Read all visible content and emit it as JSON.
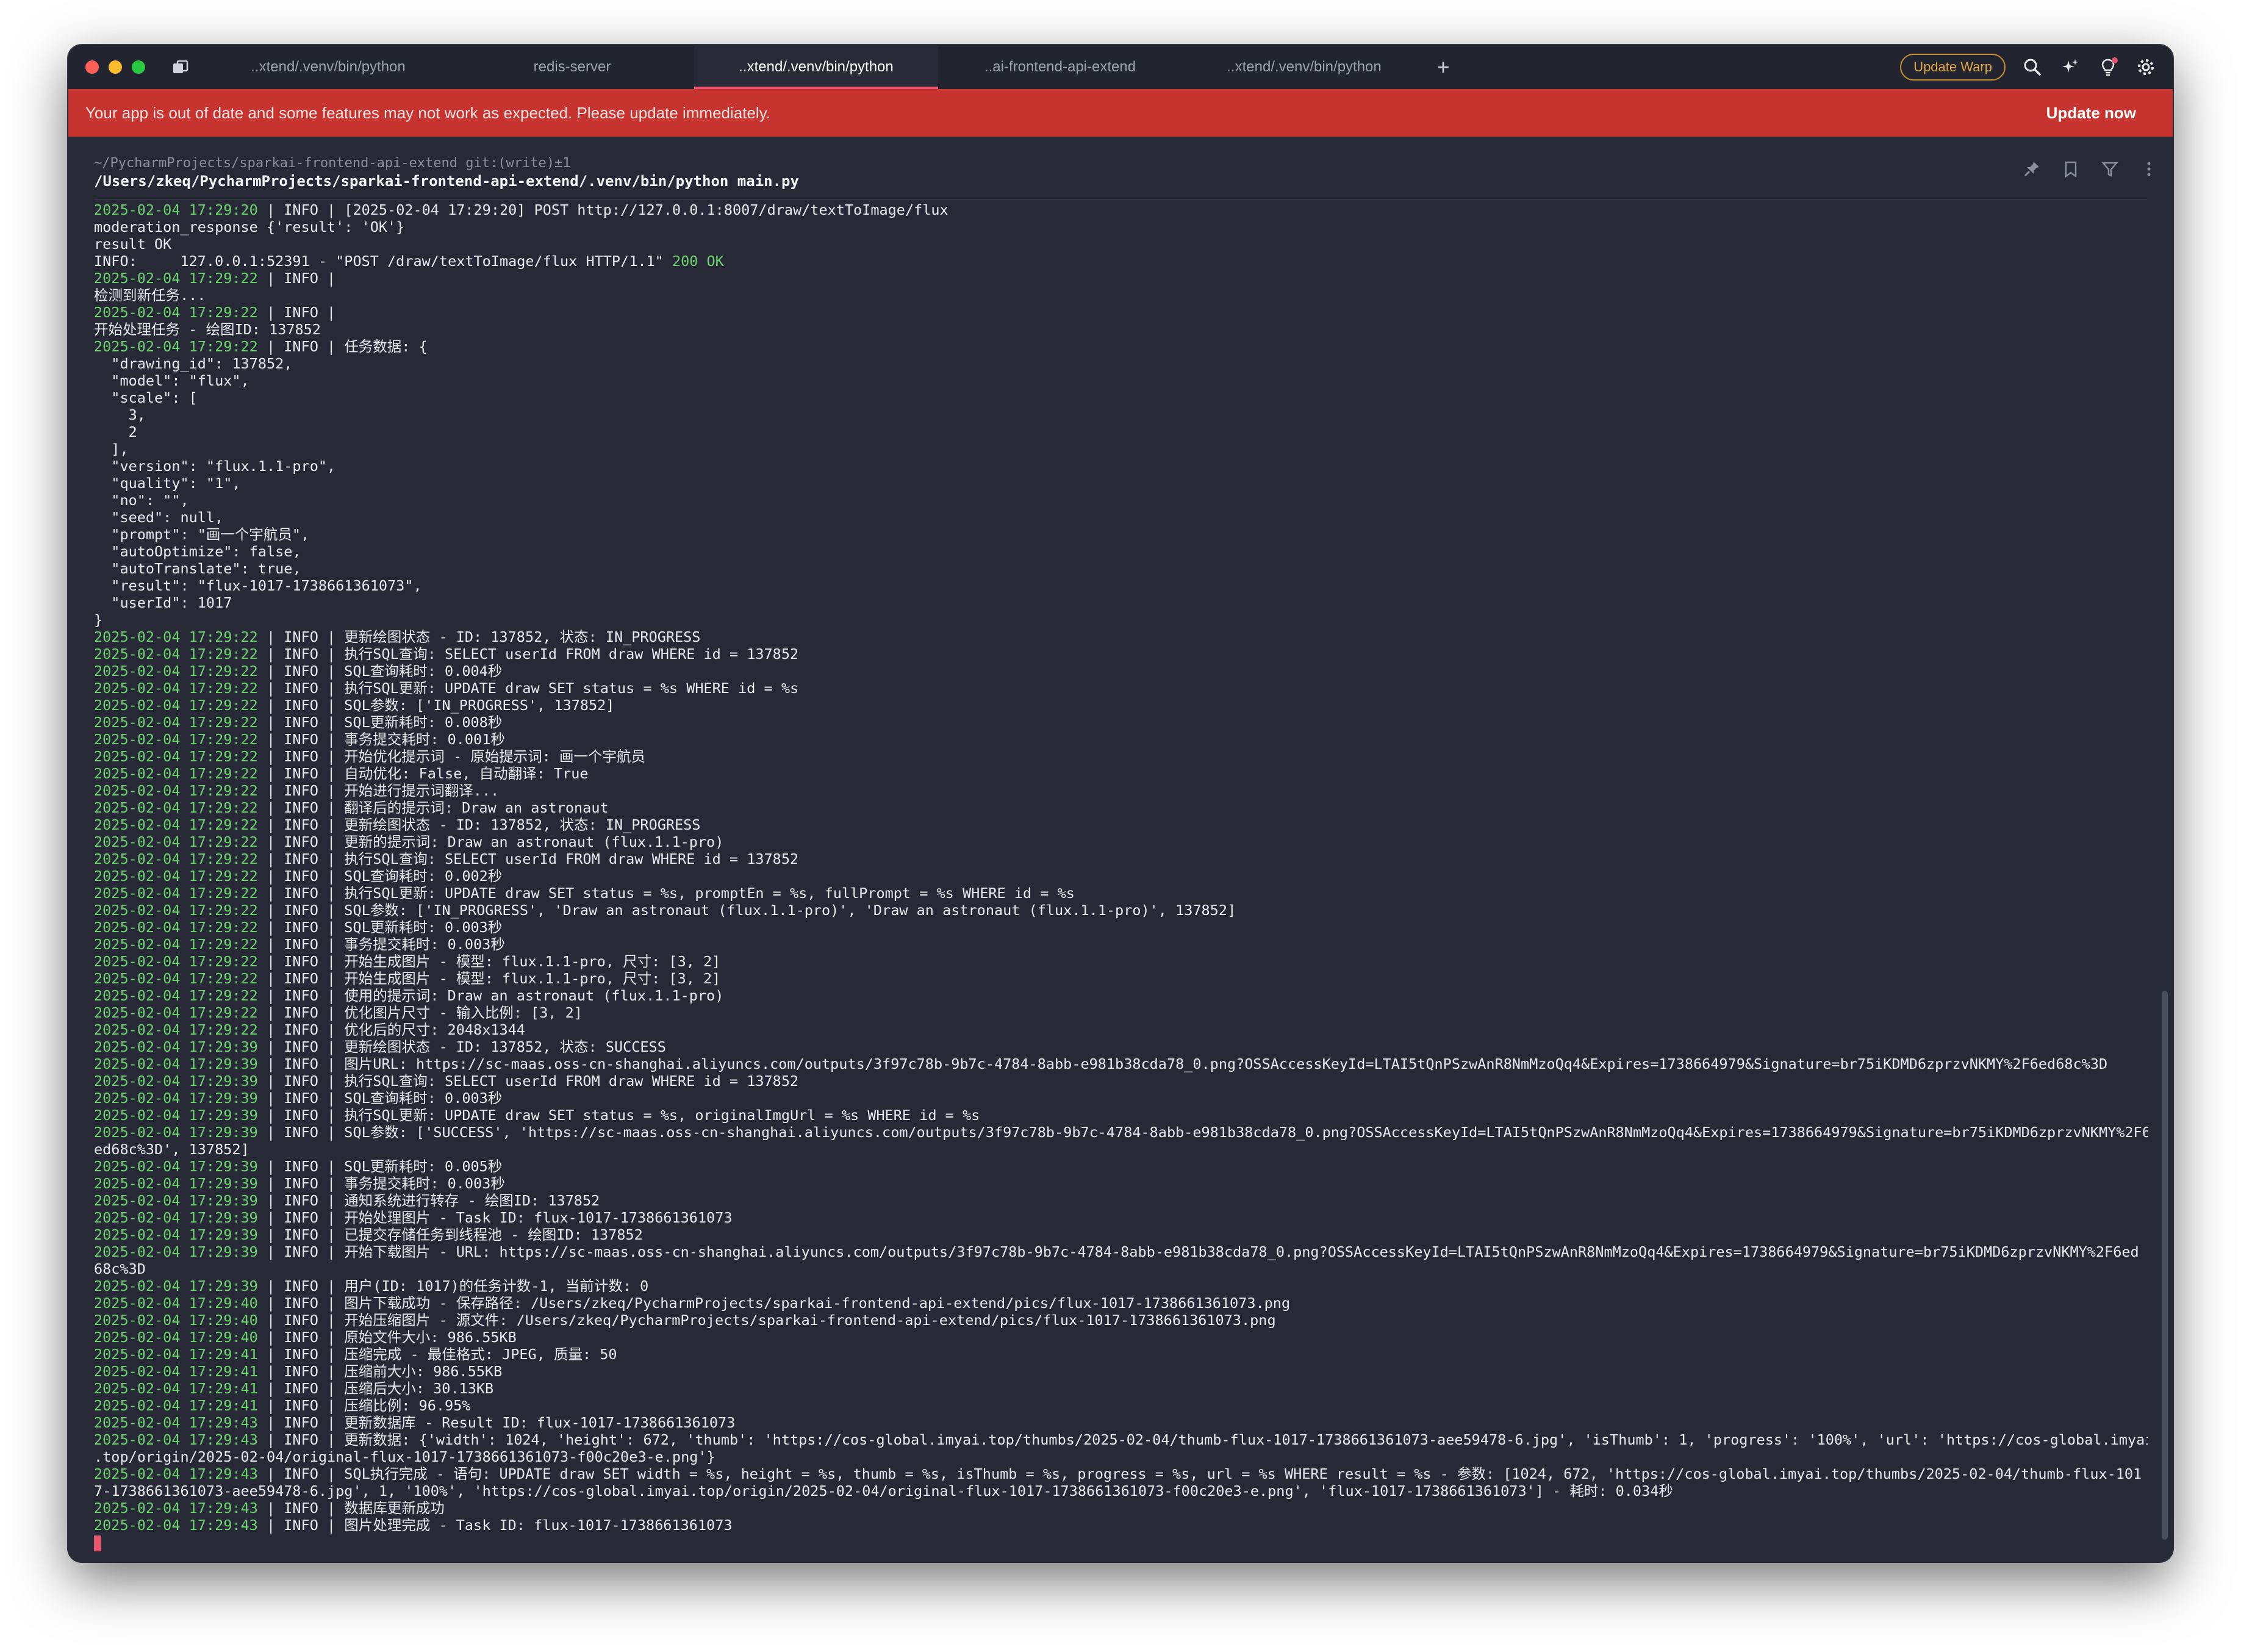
{
  "tabs": [
    {
      "label": "..xtend/.venv/bin/python",
      "active": false
    },
    {
      "label": "redis-server",
      "active": false
    },
    {
      "label": "..xtend/.venv/bin/python",
      "active": true
    },
    {
      "label": "..ai-frontend-api-extend",
      "active": false
    },
    {
      "label": "..xtend/.venv/bin/python",
      "active": false
    }
  ],
  "toolbar": {
    "new_tab": "+",
    "update_warp": "Update Warp"
  },
  "banner": {
    "message": "Your app is out of date and some features may not work as expected. Please update immediately.",
    "action": "Update now",
    "color": "#c73430"
  },
  "block": {
    "prompt": "~/PycharmProjects/sparkai-frontend-api-extend git:(write)±1",
    "command": "/Users/zkeq/PycharmProjects/sparkai-frontend-api-extend/.venv/bin/python main.py"
  },
  "log": [
    {
      "ts": "2025-02-04 17:29:20",
      "text": " | INFO | [2025-02-04 17:29:20] POST http://127.0.0.1:8007/draw/textToImage/flux"
    },
    {
      "text": "moderation_response {'result': 'OK'}"
    },
    {
      "text": "result OK"
    },
    {
      "text": "INFO:     127.0.0.1:52391 - \"POST /draw/textToImage/flux HTTP/1.1\" ",
      "ok": "200 OK"
    },
    {
      "ts": "2025-02-04 17:29:22",
      "text": " | INFO |"
    },
    {
      "text": "检测到新任务..."
    },
    {
      "ts": "2025-02-04 17:29:22",
      "text": " | INFO |"
    },
    {
      "text": "开始处理任务 - 绘图ID: 137852"
    },
    {
      "ts": "2025-02-04 17:29:22",
      "text": " | INFO | 任务数据: {"
    },
    {
      "text": "  \"drawing_id\": 137852,"
    },
    {
      "text": "  \"model\": \"flux\","
    },
    {
      "text": "  \"scale\": ["
    },
    {
      "text": "    3,"
    },
    {
      "text": "    2"
    },
    {
      "text": "  ],"
    },
    {
      "text": "  \"version\": \"flux.1.1-pro\","
    },
    {
      "text": "  \"quality\": \"1\","
    },
    {
      "text": "  \"no\": \"\","
    },
    {
      "text": "  \"seed\": null,"
    },
    {
      "text": "  \"prompt\": \"画一个宇航员\","
    },
    {
      "text": "  \"autoOptimize\": false,"
    },
    {
      "text": "  \"autoTranslate\": true,"
    },
    {
      "text": "  \"result\": \"flux-1017-1738661361073\","
    },
    {
      "text": "  \"userId\": 1017"
    },
    {
      "text": "}"
    },
    {
      "ts": "2025-02-04 17:29:22",
      "text": " | INFO | 更新绘图状态 - ID: 137852, 状态: IN_PROGRESS"
    },
    {
      "ts": "2025-02-04 17:29:22",
      "text": " | INFO | 执行SQL查询: SELECT userId FROM draw WHERE id = 137852"
    },
    {
      "ts": "2025-02-04 17:29:22",
      "text": " | INFO | SQL查询耗时: 0.004秒"
    },
    {
      "ts": "2025-02-04 17:29:22",
      "text": " | INFO | 执行SQL更新: UPDATE draw SET status = %s WHERE id = %s"
    },
    {
      "ts": "2025-02-04 17:29:22",
      "text": " | INFO | SQL参数: ['IN_PROGRESS', 137852]"
    },
    {
      "ts": "2025-02-04 17:29:22",
      "text": " | INFO | SQL更新耗时: 0.008秒"
    },
    {
      "ts": "2025-02-04 17:29:22",
      "text": " | INFO | 事务提交耗时: 0.001秒"
    },
    {
      "ts": "2025-02-04 17:29:22",
      "text": " | INFO | 开始优化提示词 - 原始提示词: 画一个宇航员"
    },
    {
      "ts": "2025-02-04 17:29:22",
      "text": " | INFO | 自动优化: False, 自动翻译: True"
    },
    {
      "ts": "2025-02-04 17:29:22",
      "text": " | INFO | 开始进行提示词翻译..."
    },
    {
      "ts": "2025-02-04 17:29:22",
      "text": " | INFO | 翻译后的提示词: Draw an astronaut"
    },
    {
      "ts": "2025-02-04 17:29:22",
      "text": " | INFO | 更新绘图状态 - ID: 137852, 状态: IN_PROGRESS"
    },
    {
      "ts": "2025-02-04 17:29:22",
      "text": " | INFO | 更新的提示词: Draw an astronaut (flux.1.1-pro)"
    },
    {
      "ts": "2025-02-04 17:29:22",
      "text": " | INFO | 执行SQL查询: SELECT userId FROM draw WHERE id = 137852"
    },
    {
      "ts": "2025-02-04 17:29:22",
      "text": " | INFO | SQL查询耗时: 0.002秒"
    },
    {
      "ts": "2025-02-04 17:29:22",
      "text": " | INFO | 执行SQL更新: UPDATE draw SET status = %s, promptEn = %s, fullPrompt = %s WHERE id = %s"
    },
    {
      "ts": "2025-02-04 17:29:22",
      "text": " | INFO | SQL参数: ['IN_PROGRESS', 'Draw an astronaut (flux.1.1-pro)', 'Draw an astronaut (flux.1.1-pro)', 137852]"
    },
    {
      "ts": "2025-02-04 17:29:22",
      "text": " | INFO | SQL更新耗时: 0.003秒"
    },
    {
      "ts": "2025-02-04 17:29:22",
      "text": " | INFO | 事务提交耗时: 0.003秒"
    },
    {
      "ts": "2025-02-04 17:29:22",
      "text": " | INFO | 开始生成图片 - 模型: flux.1.1-pro, 尺寸: [3, 2]"
    },
    {
      "ts": "2025-02-04 17:29:22",
      "text": " | INFO | 开始生成图片 - 模型: flux.1.1-pro, 尺寸: [3, 2]"
    },
    {
      "ts": "2025-02-04 17:29:22",
      "text": " | INFO | 使用的提示词: Draw an astronaut (flux.1.1-pro)"
    },
    {
      "ts": "2025-02-04 17:29:22",
      "text": " | INFO | 优化图片尺寸 - 输入比例: [3, 2]"
    },
    {
      "ts": "2025-02-04 17:29:22",
      "text": " | INFO | 优化后的尺寸: 2048x1344"
    },
    {
      "ts": "2025-02-04 17:29:39",
      "text": " | INFO | 更新绘图状态 - ID: 137852, 状态: SUCCESS"
    },
    {
      "ts": "2025-02-04 17:29:39",
      "text": " | INFO | 图片URL: https://sc-maas.oss-cn-shanghai.aliyuncs.com/outputs/3f97c78b-9b7c-4784-8abb-e981b38cda78_0.png?OSSAccessKeyId=LTAI5tQnPSzwAnR8NmMzoQq4&Expires=1738664979&Signature=br75iKDMD6zprzvNKMY%2F6ed68c%3D"
    },
    {
      "ts": "2025-02-04 17:29:39",
      "text": " | INFO | 执行SQL查询: SELECT userId FROM draw WHERE id = 137852"
    },
    {
      "ts": "2025-02-04 17:29:39",
      "text": " | INFO | SQL查询耗时: 0.003秒"
    },
    {
      "ts": "2025-02-04 17:29:39",
      "text": " | INFO | 执行SQL更新: UPDATE draw SET status = %s, originalImgUrl = %s WHERE id = %s"
    },
    {
      "ts": "2025-02-04 17:29:39",
      "text": " | INFO | SQL参数: ['SUCCESS', 'https://sc-maas.oss-cn-shanghai.aliyuncs.com/outputs/3f97c78b-9b7c-4784-8abb-e981b38cda78_0.png?OSSAccessKeyId=LTAI5tQnPSzwAnR8NmMzoQq4&Expires=1738664979&Signature=br75iKDMD6zprzvNKMY%2F6"
    },
    {
      "text": "ed68c%3D', 137852]"
    },
    {
      "ts": "2025-02-04 17:29:39",
      "text": " | INFO | SQL更新耗时: 0.005秒"
    },
    {
      "ts": "2025-02-04 17:29:39",
      "text": " | INFO | 事务提交耗时: 0.003秒"
    },
    {
      "ts": "2025-02-04 17:29:39",
      "text": " | INFO | 通知系统进行转存 - 绘图ID: 137852"
    },
    {
      "ts": "2025-02-04 17:29:39",
      "text": " | INFO | 开始处理图片 - Task ID: flux-1017-1738661361073"
    },
    {
      "ts": "2025-02-04 17:29:39",
      "text": " | INFO | 已提交存储任务到线程池 - 绘图ID: 137852"
    },
    {
      "ts": "2025-02-04 17:29:39",
      "text": " | INFO | 开始下载图片 - URL: https://sc-maas.oss-cn-shanghai.aliyuncs.com/outputs/3f97c78b-9b7c-4784-8abb-e981b38cda78_0.png?OSSAccessKeyId=LTAI5tQnPSzwAnR8NmMzoQq4&Expires=1738664979&Signature=br75iKDMD6zprzvNKMY%2F6ed"
    },
    {
      "text": "68c%3D"
    },
    {
      "ts": "2025-02-04 17:29:39",
      "text": " | INFO | 用户(ID: 1017)的任务计数-1, 当前计数: 0"
    },
    {
      "ts": "2025-02-04 17:29:40",
      "text": " | INFO | 图片下载成功 - 保存路径: /Users/zkeq/PycharmProjects/sparkai-frontend-api-extend/pics/flux-1017-1738661361073.png"
    },
    {
      "ts": "2025-02-04 17:29:40",
      "text": " | INFO | 开始压缩图片 - 源文件: /Users/zkeq/PycharmProjects/sparkai-frontend-api-extend/pics/flux-1017-1738661361073.png"
    },
    {
      "ts": "2025-02-04 17:29:40",
      "text": " | INFO | 原始文件大小: 986.55KB"
    },
    {
      "ts": "2025-02-04 17:29:41",
      "text": " | INFO | 压缩完成 - 最佳格式: JPEG, 质量: 50"
    },
    {
      "ts": "2025-02-04 17:29:41",
      "text": " | INFO | 压缩前大小: 986.55KB"
    },
    {
      "ts": "2025-02-04 17:29:41",
      "text": " | INFO | 压缩后大小: 30.13KB"
    },
    {
      "ts": "2025-02-04 17:29:41",
      "text": " | INFO | 压缩比例: 96.95%"
    },
    {
      "ts": "2025-02-04 17:29:43",
      "text": " | INFO | 更新数据库 - Result ID: flux-1017-1738661361073"
    },
    {
      "ts": "2025-02-04 17:29:43",
      "text": " | INFO | 更新数据: {'width': 1024, 'height': 672, 'thumb': 'https://cos-global.imyai.top/thumbs/2025-02-04/thumb-flux-1017-1738661361073-aee59478-6.jpg', 'isThumb': 1, 'progress': '100%', 'url': 'https://cos-global.imyai"
    },
    {
      "text": ".top/origin/2025-02-04/original-flux-1017-1738661361073-f00c20e3-e.png'}"
    },
    {
      "ts": "2025-02-04 17:29:43",
      "text": " | INFO | SQL执行完成 - 语句: UPDATE draw SET width = %s, height = %s, thumb = %s, isThumb = %s, progress = %s, url = %s WHERE result = %s - 参数: [1024, 672, 'https://cos-global.imyai.top/thumbs/2025-02-04/thumb-flux-101"
    },
    {
      "text": "7-1738661361073-aee59478-6.jpg', 1, '100%', 'https://cos-global.imyai.top/origin/2025-02-04/original-flux-1017-1738661361073-f00c20e3-e.png', 'flux-1017-1738661361073'] - 耗时: 0.034秒"
    },
    {
      "ts": "2025-02-04 17:29:43",
      "text": " | INFO | 数据库更新成功"
    },
    {
      "ts": "2025-02-04 17:29:43",
      "text": " | INFO | 图片处理完成 - Task ID: flux-1017-1738661361073"
    }
  ]
}
